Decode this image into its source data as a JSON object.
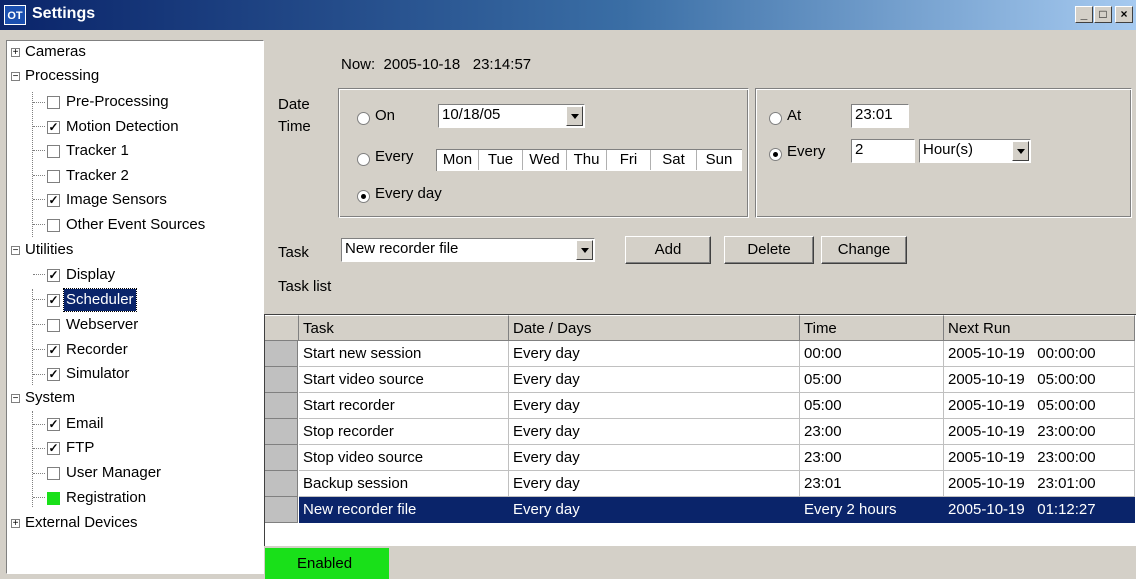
{
  "window": {
    "title": "Settings",
    "app_icon": "OT"
  },
  "title_buttons": {
    "minimize": "_",
    "maximize": "□",
    "close": "×"
  },
  "tree": {
    "cameras": "Cameras",
    "processing": "Processing",
    "preprocessing": "Pre-Processing",
    "motion_detection": "Motion Detection",
    "tracker1": "Tracker 1",
    "tracker2": "Tracker 2",
    "image_sensors": "Image Sensors",
    "other_events": "Other Event Sources",
    "utilities": "Utilities",
    "display": "Display",
    "scheduler": "Scheduler",
    "webserver": "Webserver",
    "recorder": "Recorder",
    "simulator": "Simulator",
    "system": "System",
    "email": "Email",
    "ftp": "FTP",
    "user_manager": "User Manager",
    "registration": "Registration",
    "external_devices": "External Devices"
  },
  "now": "Now:  2005-10-18   23:14:57",
  "date_label": "Date\nTime",
  "date": {
    "on_label": "On",
    "on_value": "10/18/05",
    "every_label": "Every",
    "days": [
      "Mon",
      "Tue",
      "Wed",
      "Thu",
      "Fri",
      "Sat",
      "Sun"
    ],
    "everyday_label": "Every day",
    "selected": "Every day"
  },
  "time": {
    "at_label": "At",
    "at_value": "23:01",
    "every_label": "Every",
    "every_value": "2",
    "unit": "Hour(s)",
    "selected": "Every"
  },
  "task": {
    "label": "Task",
    "value": "New recorder file",
    "add": "Add",
    "delete": "Delete",
    "change": "Change",
    "list_label": "Task list"
  },
  "grid": {
    "columns": [
      "Task",
      "Date / Days",
      "Time",
      "Next Run"
    ],
    "rows": [
      [
        "Start new session",
        "Every day",
        "00:00",
        "2005-10-19   00:00:00"
      ],
      [
        "Start video source",
        "Every day",
        "05:00",
        "2005-10-19   05:00:00"
      ],
      [
        "Start recorder",
        "Every day",
        "05:00",
        "2005-10-19   05:00:00"
      ],
      [
        "Stop recorder",
        "Every day",
        "23:00",
        "2005-10-19   23:00:00"
      ],
      [
        "Stop video source",
        "Every day",
        "23:00",
        "2005-10-19   23:00:00"
      ],
      [
        "Backup session",
        "Every day",
        "23:01",
        "2005-10-19   23:01:00"
      ],
      [
        "New recorder file",
        "Every day",
        "Every 2 hours",
        "2005-10-19   01:12:27"
      ]
    ],
    "selected_row": 6
  },
  "status": "Enabled"
}
